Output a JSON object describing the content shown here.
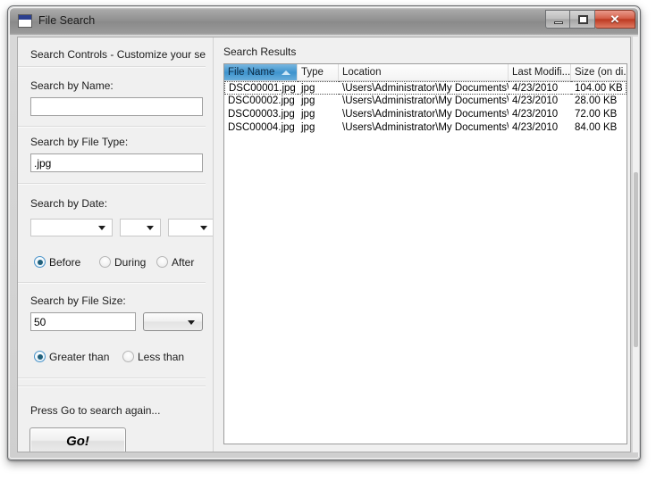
{
  "window": {
    "title": "File Search",
    "icon": "window-form-icon",
    "buttons": {
      "minimize": "minimize-icon",
      "maximize": "maximize-icon",
      "close": "✕"
    }
  },
  "left_panel": {
    "header": "Search Controls  -  Customize your searc",
    "groups": {
      "name": {
        "label": "Search by Name:",
        "value": "",
        "placeholder": ""
      },
      "file_type": {
        "label": "Search by File Type:",
        "value": ".jpg"
      },
      "date": {
        "label": "Search by Date:",
        "dropdowns": [
          "",
          "",
          ""
        ],
        "options": [
          {
            "label": "Before",
            "selected": true
          },
          {
            "label": "During",
            "selected": false
          },
          {
            "label": "After",
            "selected": false
          }
        ]
      },
      "file_size": {
        "label": "Search by File Size:",
        "value": "50",
        "unit": "",
        "options": [
          {
            "label": "Greater than",
            "selected": true
          },
          {
            "label": "Less than",
            "selected": false
          }
        ]
      },
      "action": {
        "hint": "Press Go to search again...",
        "button_label": "Go!"
      }
    }
  },
  "right_panel": {
    "label": "Search Results",
    "table": {
      "columns": [
        {
          "label": "File Name",
          "sorted": true,
          "sort_direction": "ascending"
        },
        {
          "label": "Type",
          "sorted": false
        },
        {
          "label": "Location",
          "sorted": false
        },
        {
          "label": "Last Modifi...",
          "sorted": false
        },
        {
          "label": "Size (on di...",
          "sorted": false
        }
      ],
      "rows": [
        {
          "focused": true,
          "cells": [
            "DSC00001.jpg",
            "jpg",
            "\\Users\\Administrator\\My Documents\\...",
            "4/23/2010",
            "104.00 KB"
          ]
        },
        {
          "focused": false,
          "cells": [
            "DSC00002.jpg",
            "jpg",
            "\\Users\\Administrator\\My Documents\\...",
            "4/23/2010",
            "28.00 KB"
          ]
        },
        {
          "focused": false,
          "cells": [
            "DSC00003.jpg",
            "jpg",
            "\\Users\\Administrator\\My Documents\\...",
            "4/23/2010",
            "72.00 KB"
          ]
        },
        {
          "focused": false,
          "cells": [
            "DSC00004.jpg",
            "jpg",
            "\\Users\\Administrator\\My Documents\\...",
            "4/23/2010",
            "84.00 KB"
          ]
        }
      ]
    }
  },
  "colors": {
    "accent": "#3e93cd",
    "close_button": "#bd3a22",
    "panel_background": "#f0f0f0"
  }
}
